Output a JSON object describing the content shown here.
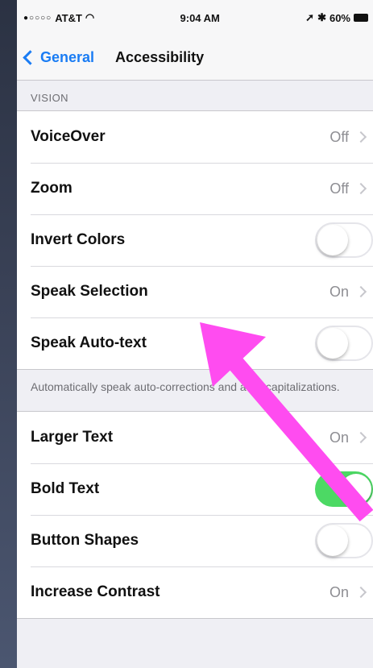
{
  "status": {
    "carrier": "AT&T",
    "time": "9:04 AM",
    "battery": "60%"
  },
  "nav": {
    "back": "General",
    "title": "Accessibility"
  },
  "vision": {
    "header": "VISION",
    "rows": [
      {
        "label": "VoiceOver",
        "value": "Off"
      },
      {
        "label": "Zoom",
        "value": "Off"
      },
      {
        "label": "Invert Colors",
        "toggle": false
      },
      {
        "label": "Speak Selection",
        "value": "On"
      },
      {
        "label": "Speak Auto-text",
        "toggle": false
      }
    ],
    "footnote": "Automatically speak auto-corrections and auto-capitalizations."
  },
  "more": {
    "rows": [
      {
        "label": "Larger Text",
        "value": "On"
      },
      {
        "label": "Bold Text",
        "toggle": true
      },
      {
        "label": "Button Shapes",
        "toggle": false
      },
      {
        "label": "Increase Contrast",
        "value": "On"
      }
    ]
  },
  "colors": {
    "accent": "#1a7cf4",
    "toggle_on": "#4cd964",
    "annotation_arrow": "#ff4cf0"
  }
}
